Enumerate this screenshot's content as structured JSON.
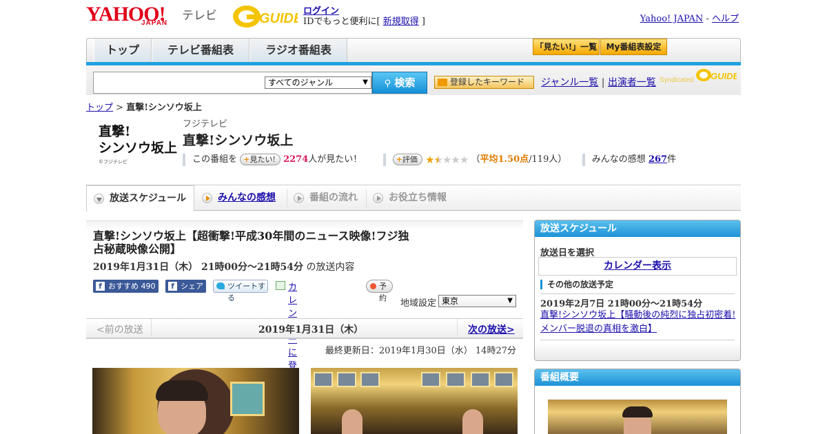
{
  "header": {
    "logo_yahoo": "YAHOO!",
    "logo_japan": "JAPAN",
    "logo_tv": "テレビ",
    "gguide_logo": "G-GUIDE",
    "login": "ログイン",
    "login_sub_prefix": "IDでもっと便利に[ ",
    "signup": "新規取得",
    "login_sub_suffix": " ]",
    "yahoo_japan_link": "Yahoo! JAPAN",
    "help_link": "ヘルプ"
  },
  "nav": {
    "tabs": [
      "トップ",
      "テレビ番組表",
      "ラジオ番組表"
    ],
    "mitai_list": "「見たい!」一覧",
    "my_schedule": "My番組表設定"
  },
  "search": {
    "input_value": "",
    "genre_select": "すべてのジャンル",
    "search_button": "検索",
    "keyword_button": "登録したキーワード",
    "genre_list": "ジャンル一覧",
    "cast_list": "出演者一覧",
    "syndicated": "Syndicated"
  },
  "breadcrumb": {
    "top": "トップ",
    "sep": " > ",
    "current": "直撃!シンソウ坂上"
  },
  "program": {
    "logo_line1": "直撃!",
    "logo_line2": "シンソウ坂上",
    "logo_credit": "©フジテレビ",
    "channel": "フジテレビ",
    "title": "直撃!シンソウ坂上",
    "mitai_prefix": "この番組を",
    "mitai_pill": "見たい!",
    "mitai_count": "2274",
    "mitai_suffix": "人が見たい！",
    "rating_pill": "評価",
    "rating_stars": 1.5,
    "rating_open": "（",
    "rating_avg": "平均1.50点",
    "rating_count": "/119人）",
    "impressions_label": "みんなの感想",
    "impressions_count": "267",
    "impressions_suffix": "件"
  },
  "tabs": [
    "放送スケジュール",
    "みんなの感想",
    "番組の流れ",
    "お役立ち情報"
  ],
  "episode": {
    "title": "直撃!シンソウ坂上【超衝撃!平成30年間のニュース映像!フジ独占秘蔵映像公開】",
    "time": "2019年1月31日（木）  21時00分～21時54分",
    "time_suffix": "の放送内容",
    "fb_recommend": "おすすめ",
    "fb_count": "490",
    "fb_share": "シェア",
    "tweet": "ツイートする",
    "calendar": "カレンダーに登録",
    "reserve": "予約",
    "region_label": "地域設定",
    "region_value": "東京",
    "prev": "<前の放送",
    "current_date": "2019年1月31日（木）",
    "next": "次の放送>",
    "updated": "最終更新日：2019年1月30日（水）  14時27分"
  },
  "sidebar": {
    "schedule_head": "放送スケジュール",
    "select_date": "放送日を選択",
    "calendar_view": "カレンダー表示",
    "other_head": "その他の放送予定",
    "other_time": "2019年2月7日  21時00分～21時54分",
    "other_link": "直撃!シンソウ坂上【騒動後の純烈に独占初密着!メンバー脱退の真相を激白】",
    "overview_head": "番組概要"
  },
  "colors": {
    "accent_blue": "#1ea0e0",
    "yahoo_red": "#e0001b",
    "link": "#1a0dab",
    "orange": "#f5a800"
  }
}
